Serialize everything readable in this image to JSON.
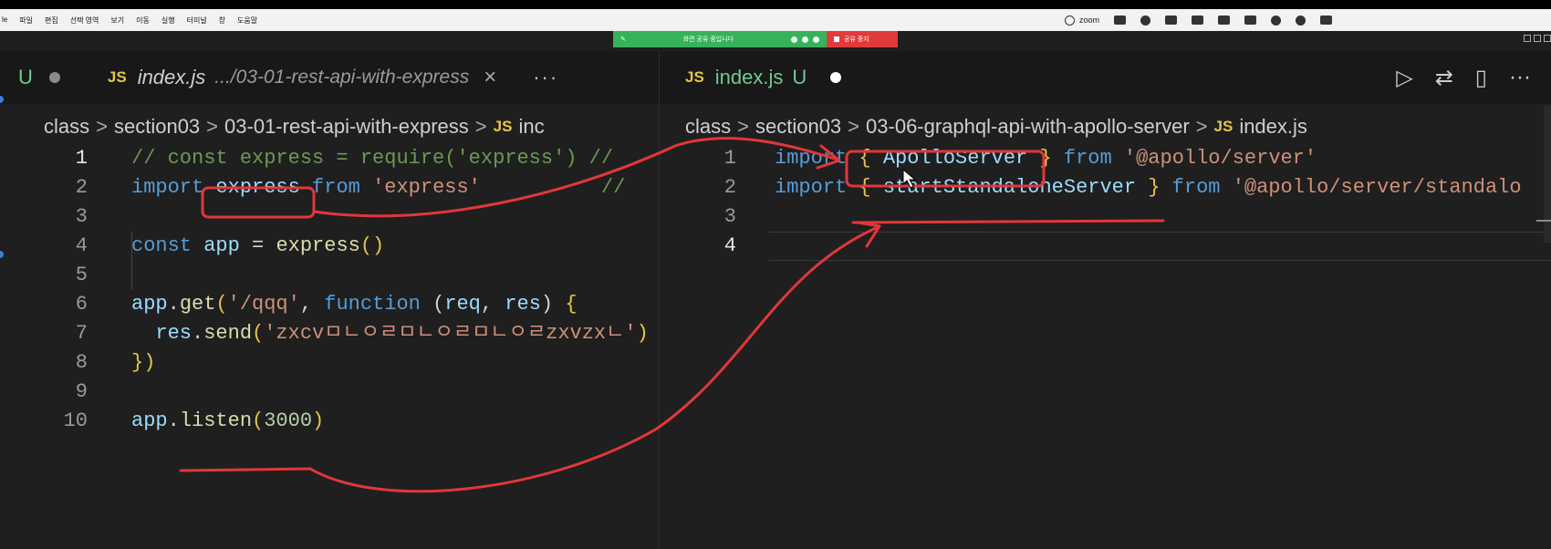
{
  "menubar": {
    "items": [
      "le",
      "파일",
      "편집",
      "선택 영역",
      "보기",
      "이동",
      "실행",
      "터미널",
      "창",
      "도움말"
    ],
    "zoom_label": "zoom"
  },
  "share_banner": {
    "sharing_text": "화면 공유 중입니다",
    "stop_text": "공유 중지",
    "colors": {
      "green": "#36b35a",
      "red": "#e03b3b"
    }
  },
  "left_editor": {
    "tab": {
      "modified_marker": "U",
      "file_icon": "JS",
      "file_name": "index.js",
      "path": ".../03-01-rest-api-with-express",
      "close_label": "×",
      "more_label": "···"
    },
    "breadcrumb": [
      "class",
      "section03",
      "03-01-rest-api-with-express",
      "inc"
    ],
    "breadcrumb_file_icon": "JS",
    "lines": [
      {
        "num": "1",
        "tokens": [
          {
            "t": "// const express = require('express') // ",
            "c": "c-comment"
          }
        ]
      },
      {
        "num": "2",
        "tokens": [
          {
            "t": "import ",
            "c": "c-kw"
          },
          {
            "t": "express",
            "c": "c-id"
          },
          {
            "t": " from ",
            "c": "c-kw"
          },
          {
            "t": "'express'",
            "c": "c-str"
          },
          {
            "t": "          // ",
            "c": "c-comment"
          }
        ]
      },
      {
        "num": "3",
        "tokens": []
      },
      {
        "num": "4",
        "tokens": [
          {
            "t": "const ",
            "c": "c-kw"
          },
          {
            "t": "app",
            "c": "c-id"
          },
          {
            "t": " = ",
            "c": "c-plain"
          },
          {
            "t": "express",
            "c": "c-fn"
          },
          {
            "t": "()",
            "c": "c-brace"
          }
        ]
      },
      {
        "num": "5",
        "tokens": []
      },
      {
        "num": "6",
        "tokens": [
          {
            "t": "app",
            "c": "c-id"
          },
          {
            "t": ".",
            "c": "c-plain"
          },
          {
            "t": "get",
            "c": "c-fn"
          },
          {
            "t": "(",
            "c": "c-brace"
          },
          {
            "t": "'/qqq'",
            "c": "c-str"
          },
          {
            "t": ", ",
            "c": "c-plain"
          },
          {
            "t": "function",
            "c": "c-kw"
          },
          {
            "t": " (",
            "c": "c-plain"
          },
          {
            "t": "req",
            "c": "c-id"
          },
          {
            "t": ", ",
            "c": "c-plain"
          },
          {
            "t": "res",
            "c": "c-id"
          },
          {
            "t": ") ",
            "c": "c-plain"
          },
          {
            "t": "{",
            "c": "c-brace"
          }
        ]
      },
      {
        "num": "7",
        "tokens": [
          {
            "t": "  res",
            "c": "c-id"
          },
          {
            "t": ".",
            "c": "c-plain"
          },
          {
            "t": "send",
            "c": "c-fn"
          },
          {
            "t": "(",
            "c": "c-brace"
          },
          {
            "t": "'zxcvㅁㄴㅇㄹㅁㄴㅇㄹㅁㄴㅇㄹzxvzxㄴ'",
            "c": "c-str"
          },
          {
            "t": ")",
            "c": "c-brace"
          }
        ]
      },
      {
        "num": "8",
        "tokens": [
          {
            "t": "})",
            "c": "c-brace"
          }
        ]
      },
      {
        "num": "9",
        "tokens": []
      },
      {
        "num": "10",
        "tokens": [
          {
            "t": "app",
            "c": "c-id"
          },
          {
            "t": ".",
            "c": "c-plain"
          },
          {
            "t": "listen",
            "c": "c-fn"
          },
          {
            "t": "(",
            "c": "c-brace"
          },
          {
            "t": "3000",
            "c": "c-num"
          },
          {
            "t": ")",
            "c": "c-brace"
          }
        ]
      }
    ]
  },
  "right_editor": {
    "tab": {
      "file_icon": "JS",
      "file_name": "index.js",
      "modified_marker": "U"
    },
    "actions": [
      "▷",
      "⇄",
      "▯",
      "···"
    ],
    "breadcrumb": [
      "class",
      "section03",
      "03-06-graphql-api-with-apollo-server",
      "index.js"
    ],
    "breadcrumb_file_icon": "JS",
    "lines": [
      {
        "num": "1",
        "tokens": [
          {
            "t": "import ",
            "c": "c-kw"
          },
          {
            "t": "{ ",
            "c": "c-brace"
          },
          {
            "t": "ApolloServer",
            "c": "c-id"
          },
          {
            "t": " }",
            "c": "c-brace"
          },
          {
            "t": " from ",
            "c": "c-kw"
          },
          {
            "t": "'@apollo/server'",
            "c": "c-str"
          }
        ]
      },
      {
        "num": "2",
        "tokens": [
          {
            "t": "import ",
            "c": "c-kw"
          },
          {
            "t": "{ ",
            "c": "c-brace"
          },
          {
            "t": "startStandaloneServer",
            "c": "c-id"
          },
          {
            "t": " }",
            "c": "c-brace"
          },
          {
            "t": " from ",
            "c": "c-kw"
          },
          {
            "t": "'@apollo/server/standalo",
            "c": "c-str"
          }
        ]
      },
      {
        "num": "3",
        "tokens": []
      },
      {
        "num": "4",
        "tokens": []
      }
    ]
  }
}
